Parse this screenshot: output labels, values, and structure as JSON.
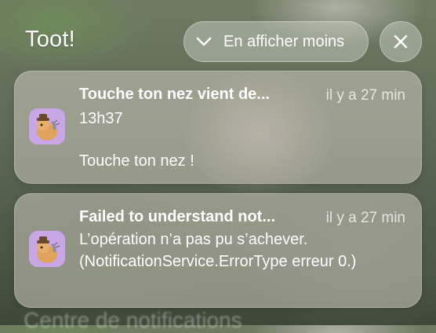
{
  "header": {
    "app_title": "Toot!",
    "collapse_label": "En afficher moins",
    "collapse_icon": "chevron-down-icon",
    "close_icon": "close-icon"
  },
  "notifications": [
    {
      "title": "Touche ton nez vient de...",
      "time": "il y a 27 min",
      "subtitle": "13h37",
      "body": "Touche ton nez !",
      "icon": "mastodon-app-icon"
    },
    {
      "title": "Failed to understand not...",
      "time": "il y a 27 min",
      "body": "L’opération n’a pas pu s’achever. (NotificationService.ErrorType erreur 0.)",
      "icon": "mastodon-app-icon"
    }
  ],
  "background_text": "Centre de notifications",
  "colors": {
    "icon_bg": "#c9a6e6",
    "text": "#ffffff",
    "card_bg": "rgba(205,200,190,0.55)"
  }
}
